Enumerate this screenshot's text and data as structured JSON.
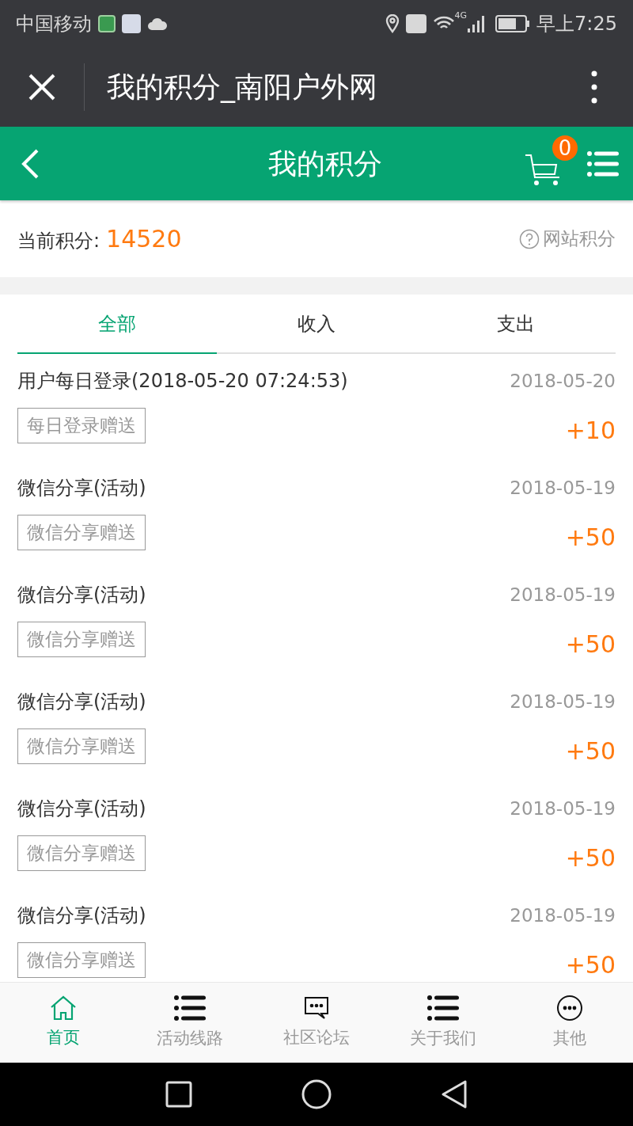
{
  "status_bar": {
    "carrier": "中国移动",
    "network": "4G",
    "time": "早上7:25"
  },
  "browser_bar": {
    "title": "我的积分_南阳户外网"
  },
  "header": {
    "title": "我的积分",
    "cart_count": "0"
  },
  "points": {
    "label": "当前积分:",
    "value": "14520",
    "help": "网站积分"
  },
  "tabs": [
    {
      "label": "全部",
      "selected": true
    },
    {
      "label": "收入",
      "selected": false
    },
    {
      "label": "支出",
      "selected": false
    }
  ],
  "records": [
    {
      "title": "用户每日登录(2018-05-20 07:24:53)",
      "date": "2018-05-20",
      "tag": "每日登录赠送",
      "amount": "+10"
    },
    {
      "title": "微信分享(活动)",
      "date": "2018-05-19",
      "tag": "微信分享赠送",
      "amount": "+50"
    },
    {
      "title": "微信分享(活动)",
      "date": "2018-05-19",
      "tag": "微信分享赠送",
      "amount": "+50"
    },
    {
      "title": "微信分享(活动)",
      "date": "2018-05-19",
      "tag": "微信分享赠送",
      "amount": "+50"
    },
    {
      "title": "微信分享(活动)",
      "date": "2018-05-19",
      "tag": "微信分享赠送",
      "amount": "+50"
    },
    {
      "title": "微信分享(活动)",
      "date": "2018-05-19",
      "tag": "微信分享赠送",
      "amount": "+50"
    }
  ],
  "bottom_nav": [
    {
      "kind": "home",
      "label": "首页",
      "selected": true
    },
    {
      "kind": "list",
      "label": "活动线路",
      "selected": false
    },
    {
      "kind": "chat",
      "label": "社区论坛",
      "selected": false
    },
    {
      "kind": "list",
      "label": "关于我们",
      "selected": false
    },
    {
      "kind": "more",
      "label": "其他",
      "selected": false
    }
  ]
}
